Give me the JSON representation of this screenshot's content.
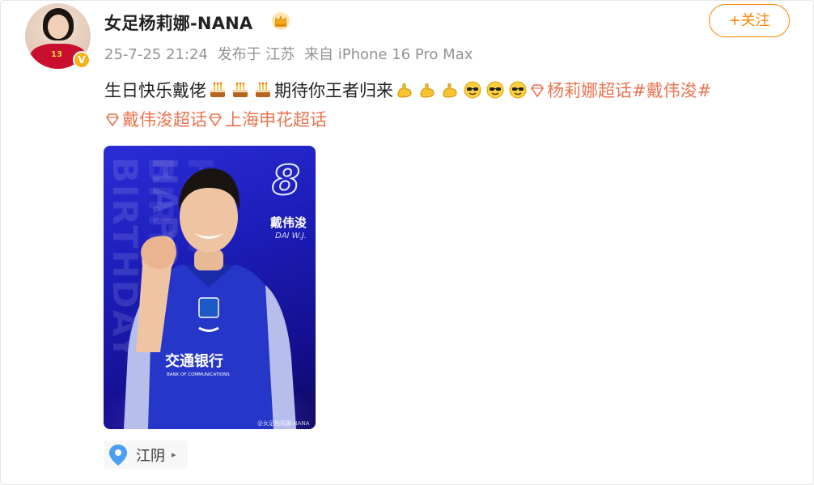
{
  "user": {
    "name": "女足杨莉娜-NANA",
    "avatar_jersey": "13",
    "verified_badge": "V"
  },
  "meta": {
    "timestamp": "25-7-25 21:24",
    "published_from": "发布于 江苏",
    "device": "来自 iPhone 16 Pro Max"
  },
  "follow_button": {
    "label": "+关注"
  },
  "post": {
    "text_1": "生日快乐戴佬",
    "text_2": "期待你王者归来",
    "topic_1": "杨莉娜超话",
    "topic_2": "#戴伟浚#",
    "topic_3": "戴伟浚超话",
    "topic_4": "上海申花超话"
  },
  "image": {
    "jersey_number": "8",
    "player_name": "戴伟浚",
    "player_name_en": "DAI W.J.",
    "background_text": "HAPPY BIRTHDAY",
    "watermark": "@女足杨莉娜-NANA"
  },
  "location": {
    "name": "江阴"
  },
  "colors": {
    "accent": "#ff8200",
    "topic": "#eb7350",
    "meta": "#939393"
  }
}
